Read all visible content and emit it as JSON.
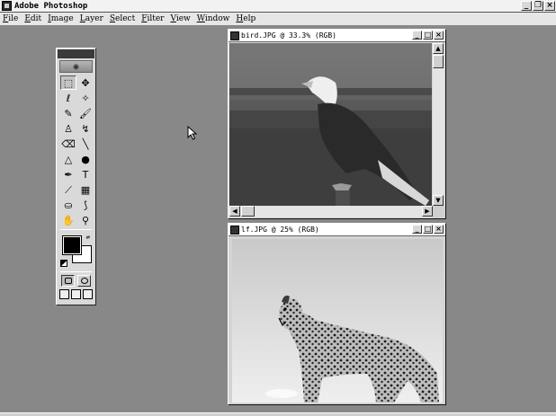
{
  "app": {
    "title": "Adobe Photoshop",
    "controls": {
      "minimize": "_",
      "restore": "❐",
      "close": "×"
    }
  },
  "menu": [
    "File",
    "Edit",
    "Image",
    "Layer",
    "Select",
    "Filter",
    "View",
    "Window",
    "Help"
  ],
  "toolbox": {
    "tools": [
      {
        "name": "marquee-tool-icon",
        "glyph": "⬚",
        "selected": true
      },
      {
        "name": "move-tool-icon",
        "glyph": "✥"
      },
      {
        "name": "lasso-tool-icon",
        "glyph": "ℓ"
      },
      {
        "name": "magic-wand-tool-icon",
        "glyph": "✧"
      },
      {
        "name": "airbrush-tool-icon",
        "glyph": "✎"
      },
      {
        "name": "paintbrush-tool-icon",
        "glyph": "🖌"
      },
      {
        "name": "rubber-stamp-tool-icon",
        "glyph": "♙"
      },
      {
        "name": "history-brush-tool-icon",
        "glyph": "↯"
      },
      {
        "name": "eraser-tool-icon",
        "glyph": "⌫"
      },
      {
        "name": "line-tool-icon",
        "glyph": "╲"
      },
      {
        "name": "blur-tool-icon",
        "glyph": "△"
      },
      {
        "name": "burn-tool-icon",
        "glyph": "●"
      },
      {
        "name": "pen-tool-icon",
        "glyph": "✒"
      },
      {
        "name": "type-tool-icon",
        "glyph": "T"
      },
      {
        "name": "measure-tool-icon",
        "glyph": "⟋"
      },
      {
        "name": "gradient-tool-icon",
        "glyph": "▦"
      },
      {
        "name": "paint-bucket-tool-icon",
        "glyph": "⛀"
      },
      {
        "name": "eyedropper-tool-icon",
        "glyph": "⟆"
      },
      {
        "name": "hand-tool-icon",
        "glyph": "✋"
      },
      {
        "name": "zoom-tool-icon",
        "glyph": "⚲"
      }
    ],
    "foreground_color": "#000000",
    "background_color": "#ffffff"
  },
  "documents": [
    {
      "title": "bird.JPG @ 33.3% (RGB)"
    },
    {
      "title": "lf.JPG @ 25% (RGB)"
    }
  ]
}
